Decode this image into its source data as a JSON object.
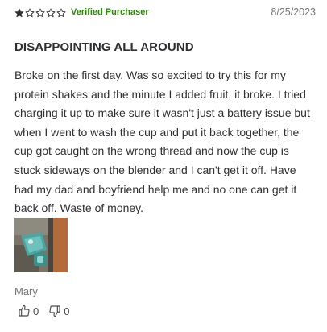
{
  "review": {
    "rating": 1,
    "max_rating": 5,
    "verified_label": "Verified Purchaser",
    "date": "8/25/2023",
    "title": "DISAPPOINTING ALL AROUND",
    "body": "Broke on the first day. Was so excited to try this for my protein shakes and the minute I added fruit, it broke. I tried charging it up to make sure it wasn't just a battery issue but when I went to wash the cup and put it back together, the cup got caught on the wrong thread and now the cup is stuck sideways on the blender and I can't get it off. Have had my dad and boyfriend help me and no one can get it back off. Waste of money.",
    "reviewer": "Mary",
    "helpful_count": "0",
    "unhelpful_count": "0"
  },
  "icons": {
    "star_filled": "star-filled-icon",
    "star_empty": "star-outline-icon",
    "thumbs_up": "thumbs-up-icon",
    "thumbs_down": "thumbs-down-icon"
  },
  "colors": {
    "star": "#2e2f32",
    "verified": "#2a8703",
    "text": "#2e2f32",
    "muted": "#74767c"
  }
}
